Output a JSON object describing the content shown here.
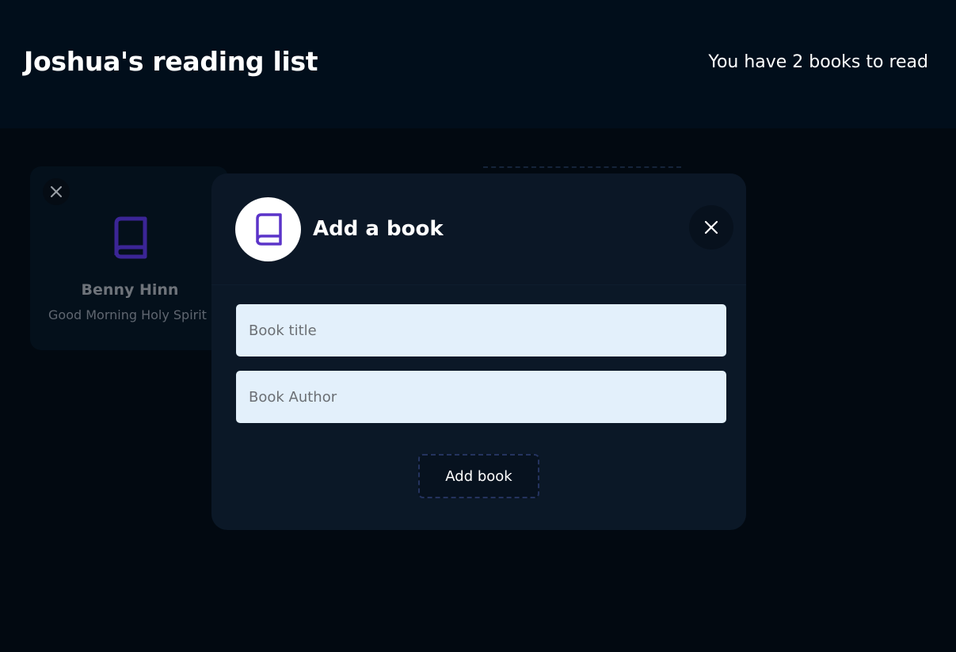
{
  "header": {
    "title": "Joshua's reading list",
    "book_count_text": "You have 2 books to read"
  },
  "books": [
    {
      "author": "Benny Hinn",
      "title": "Good Morning Holy Spirit",
      "icon": "book-icon"
    }
  ],
  "modal": {
    "title": "Add a book",
    "icon": "book-icon",
    "close_icon": "close-icon",
    "title_placeholder": "Book title",
    "author_placeholder": "Book Author",
    "title_value": "",
    "author_value": "",
    "submit_label": "Add book"
  },
  "colors": {
    "accent": "#5b34c9",
    "card_icon": "#3b2596",
    "input_bg": "#e3f0fb",
    "modal_bg": "#0b1827",
    "page_bg": "#020a13"
  }
}
